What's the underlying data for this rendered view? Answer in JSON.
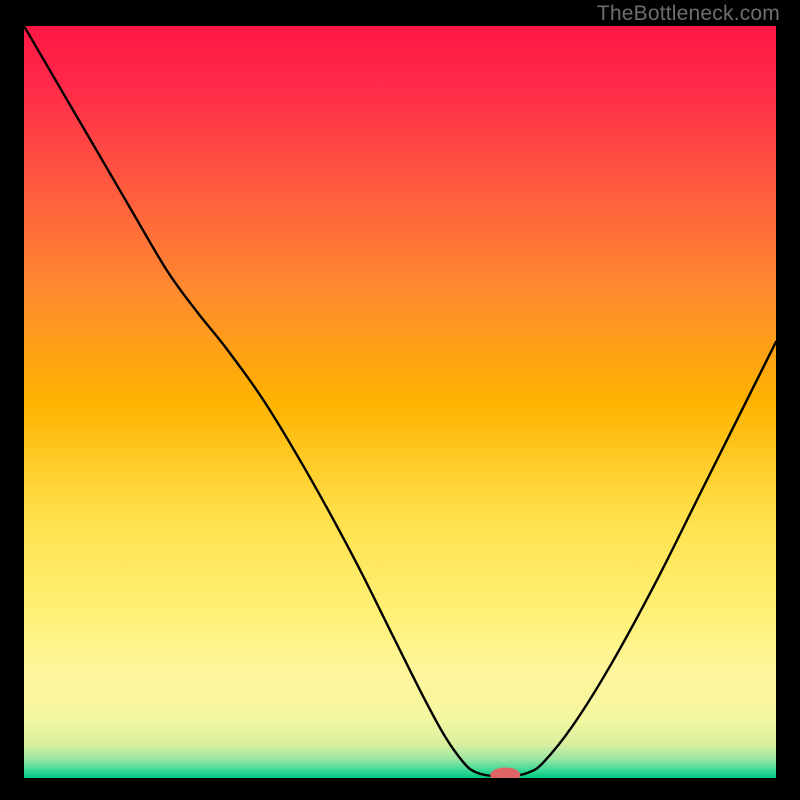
{
  "watermark": "TheBottleneck.com",
  "chart_data": {
    "type": "line",
    "title": "",
    "xlabel": "",
    "ylabel": "",
    "xlim": [
      0,
      100
    ],
    "ylim": [
      0,
      100
    ],
    "gradient_stops": [
      {
        "offset": 0.0,
        "color": "#ff1744"
      },
      {
        "offset": 0.08,
        "color": "#ff2a4a"
      },
      {
        "offset": 0.2,
        "color": "#ff5540"
      },
      {
        "offset": 0.35,
        "color": "#ff8a30"
      },
      {
        "offset": 0.5,
        "color": "#ffb300"
      },
      {
        "offset": 0.65,
        "color": "#ffe04a"
      },
      {
        "offset": 0.78,
        "color": "#fff176"
      },
      {
        "offset": 0.86,
        "color": "#fff59d"
      },
      {
        "offset": 0.92,
        "color": "#f4f7a0"
      },
      {
        "offset": 0.955,
        "color": "#d8f0a0"
      },
      {
        "offset": 0.975,
        "color": "#9ae6a3"
      },
      {
        "offset": 0.99,
        "color": "#38d996"
      },
      {
        "offset": 1.0,
        "color": "#00c97f"
      }
    ],
    "curve": [
      {
        "x": 0.0,
        "y": 100.0
      },
      {
        "x": 7.0,
        "y": 88.0
      },
      {
        "x": 14.0,
        "y": 76.0
      },
      {
        "x": 19.0,
        "y": 67.5
      },
      {
        "x": 23.0,
        "y": 62.0
      },
      {
        "x": 27.0,
        "y": 57.0
      },
      {
        "x": 32.0,
        "y": 50.0
      },
      {
        "x": 38.0,
        "y": 40.0
      },
      {
        "x": 44.0,
        "y": 29.0
      },
      {
        "x": 49.0,
        "y": 19.0
      },
      {
        "x": 53.0,
        "y": 11.0
      },
      {
        "x": 56.0,
        "y": 5.5
      },
      {
        "x": 58.5,
        "y": 2.0
      },
      {
        "x": 60.0,
        "y": 0.8
      },
      {
        "x": 62.0,
        "y": 0.3
      },
      {
        "x": 65.0,
        "y": 0.3
      },
      {
        "x": 67.0,
        "y": 0.7
      },
      {
        "x": 69.0,
        "y": 2.0
      },
      {
        "x": 73.0,
        "y": 7.0
      },
      {
        "x": 78.0,
        "y": 15.0
      },
      {
        "x": 84.0,
        "y": 26.0
      },
      {
        "x": 90.0,
        "y": 38.0
      },
      {
        "x": 95.0,
        "y": 48.0
      },
      {
        "x": 100.0,
        "y": 58.0
      }
    ],
    "marker": {
      "x": 64.0,
      "y": 0.4,
      "rx": 2.0,
      "ry": 1.0,
      "color": "#e06666"
    }
  }
}
